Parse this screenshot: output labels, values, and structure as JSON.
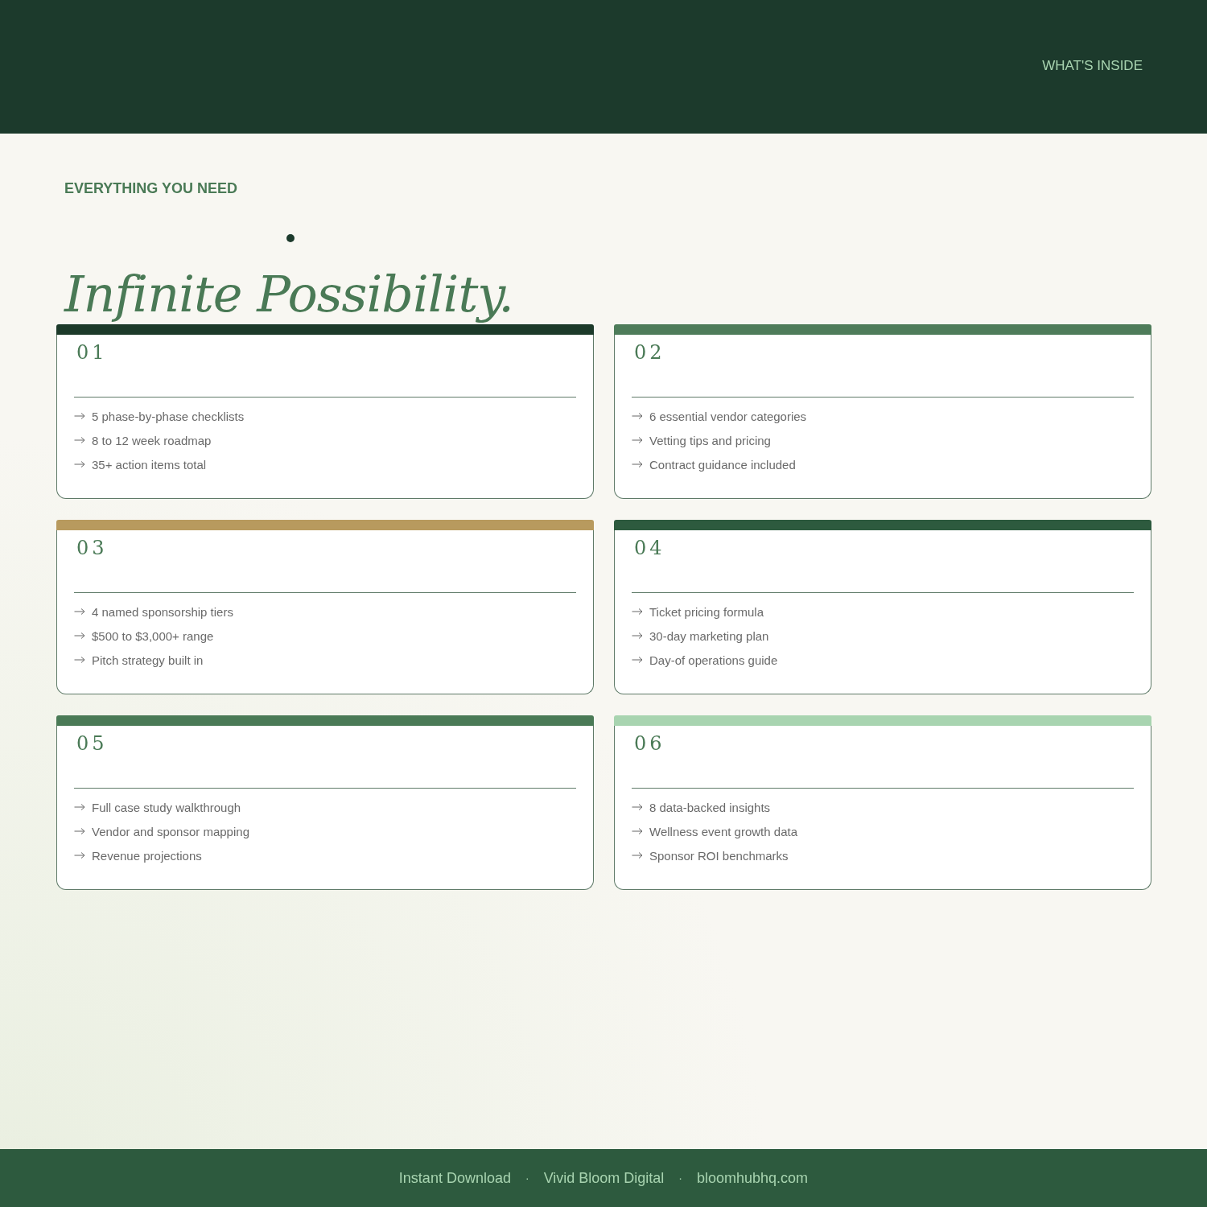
{
  "header": {
    "nav_label": "WHAT'S INSIDE"
  },
  "eyebrow": "EVERYTHING YOU NEED",
  "headline": "Infinite Possibility.",
  "cards": [
    {
      "number": "01",
      "color": "#1c3a2a",
      "items": [
        "5 phase-by-phase checklists",
        "8 to 12 week roadmap",
        "35+ action items total"
      ]
    },
    {
      "number": "02",
      "color": "#4e7c5a",
      "items": [
        "6 essential vendor categories",
        "Vetting tips and pricing",
        "Contract guidance included"
      ]
    },
    {
      "number": "03",
      "color": "#b89a5e",
      "items": [
        "4 named sponsorship tiers",
        "$500 to $3,000+ range",
        "Pitch strategy built in"
      ]
    },
    {
      "number": "04",
      "color": "#2d5a3e",
      "items": [
        "Ticket pricing formula",
        "30-day marketing plan",
        "Day-of operations guide"
      ]
    },
    {
      "number": "05",
      "color": "#4a7a56",
      "items": [
        "Full case study walkthrough",
        "Vendor and sponsor mapping",
        "Revenue projections"
      ]
    },
    {
      "number": "06",
      "color": "#a8d4b0",
      "items": [
        "8 data-backed insights",
        "Wellness event growth data",
        "Sponsor ROI benchmarks"
      ]
    }
  ],
  "footer": {
    "items": [
      "Instant Download",
      "Vivid Bloom Digital",
      "bloomhubhq.com"
    ],
    "separator": "·"
  }
}
